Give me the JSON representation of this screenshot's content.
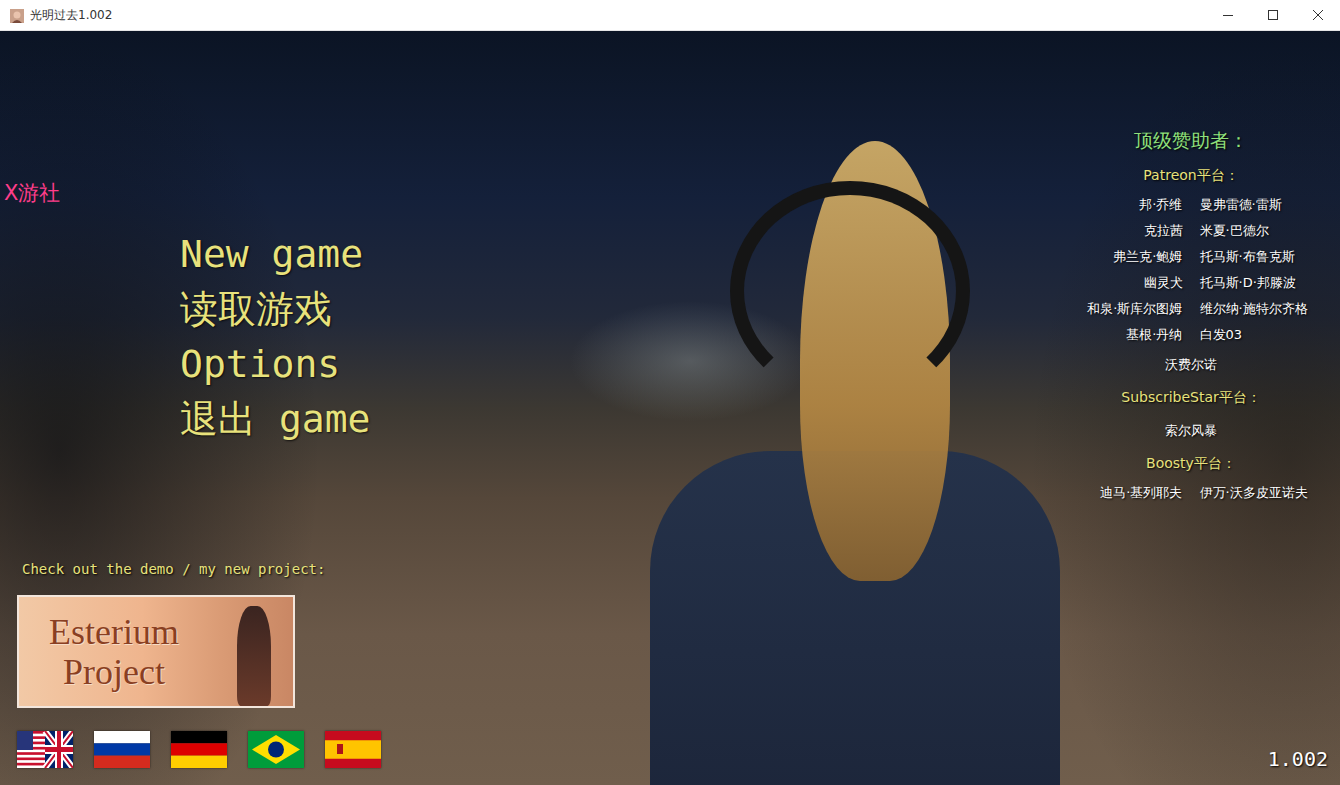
{
  "window": {
    "title": "光明过去1.002"
  },
  "watermark": "X游社",
  "menu": {
    "items": [
      "New game",
      "读取游戏",
      "Options",
      "退出 game"
    ]
  },
  "sponsors": {
    "title": "顶级赞助者：",
    "groups": [
      {
        "platform": "Patreon平台：",
        "names": [
          "邦·乔维",
          "曼弗雷德·雷斯",
          "克拉茜",
          "米夏·巴德尔",
          "弗兰克·鲍姆",
          "托马斯·布鲁克斯",
          "幽灵犬",
          "托马斯·D·邦滕波",
          "和泉·斯库尔图姆",
          "维尔纳·施特尔齐格",
          "基根·丹纳",
          "白发03",
          "沃费尔诺"
        ]
      },
      {
        "platform": "SubscribeStar平台：",
        "names": [
          "索尔风暴"
        ]
      },
      {
        "platform": "Boosty平台：",
        "names": [
          "迪马·基列耶夫",
          "伊万·沃多皮亚诺夫"
        ]
      }
    ]
  },
  "promo": {
    "caption": "Check out the demo / my new project:",
    "banner": "Esterium Project"
  },
  "version": "1.002"
}
